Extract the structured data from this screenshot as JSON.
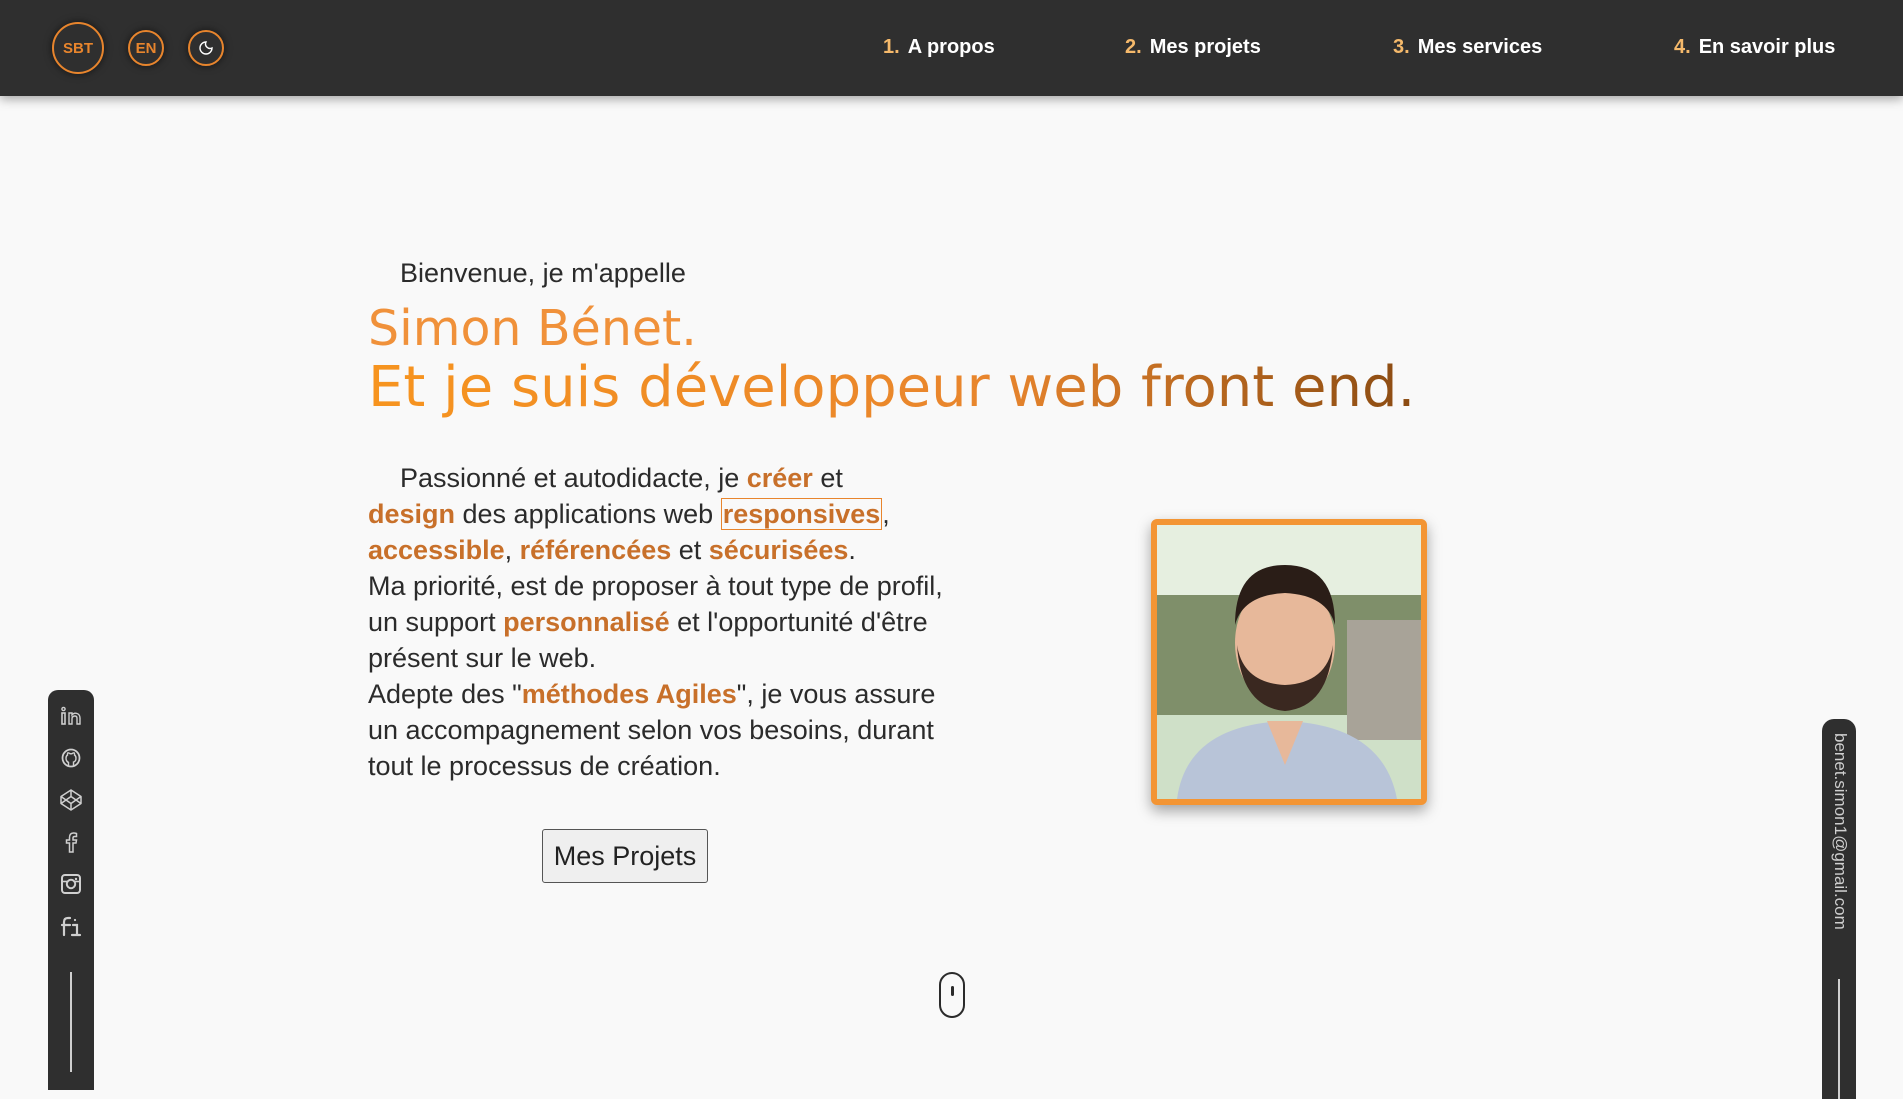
{
  "header": {
    "logo": "SBT",
    "lang": "EN",
    "theme_icon": "moon-icon",
    "nav": [
      {
        "num": "1.",
        "label": "A propos"
      },
      {
        "num": "2.",
        "label": "Mes projets"
      },
      {
        "num": "3.",
        "label": "Mes services"
      },
      {
        "num": "4.",
        "label": "En savoir plus"
      }
    ]
  },
  "hero": {
    "welcome": "Bienvenue, je m'appelle",
    "name": "Simon Bénet.",
    "role": "Et je suis développeur web front end.",
    "intro": {
      "p1a": "Passionné et autodidacte, je ",
      "creer": "créer",
      "p1b": " et",
      "design": "design",
      "p1c": " des applications web ",
      "responsives": "responsives",
      "comma1": ",",
      "accessible": "accessible",
      "comma2": ", ",
      "referencees": "référencées",
      "et": " et ",
      "securisees": "sécurisées",
      "dot": ".",
      "p2a": "Ma priorité, est de proposer à tout type de profil, un support ",
      "personnalise": "personnalisé",
      "p2b": " et l'opportunité d'être présent sur le web.",
      "p3a": "Adepte des \"",
      "agiles": "méthodes Agiles",
      "p3b": "\", je vous assure un accompagnement selon vos besoins, durant tout le processus de création."
    },
    "button": "Mes Projets"
  },
  "sidebar": {
    "socials": [
      "linkedin-icon",
      "github-icon",
      "codepen-icon",
      "facebook-icon",
      "instagram-icon",
      "freelance-icon"
    ],
    "email": "benet.simon1@gmail.com"
  },
  "colors": {
    "accent": "#e8852d",
    "header_bg": "#2f2f2f",
    "highlight": "#c8702a"
  }
}
